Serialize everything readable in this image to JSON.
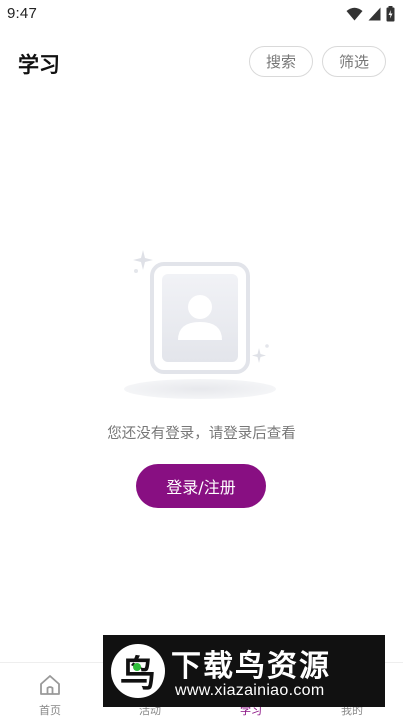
{
  "status_bar": {
    "time": "9:47",
    "icons": [
      "wifi-icon",
      "signal-icon",
      "battery-icon"
    ]
  },
  "header": {
    "title": "学习",
    "search_label": "搜索",
    "filter_label": "筛选"
  },
  "empty_state": {
    "illustration": "user-card-illustration",
    "message": "您还没有登录，请登录后查看",
    "login_button_label": "登录/注册"
  },
  "tab_bar": {
    "items": [
      {
        "label": "首页",
        "icon": "home-icon",
        "active": false
      },
      {
        "label": "活动",
        "icon": "activity-icon",
        "active": false
      },
      {
        "label": "学习",
        "icon": "study-icon",
        "active": true
      },
      {
        "label": "我的",
        "icon": "profile-icon",
        "active": false
      }
    ]
  },
  "watermark": {
    "logo_glyph": "鸟",
    "title": "下载鸟资源",
    "url": "www.xiazainiao.com"
  },
  "colors": {
    "accent": "#880f82",
    "text_primary": "#111111",
    "text_secondary": "#777777",
    "border": "#d9d9d9",
    "watermark_bg": "#111111",
    "watermark_green": "#2fbf3a"
  }
}
